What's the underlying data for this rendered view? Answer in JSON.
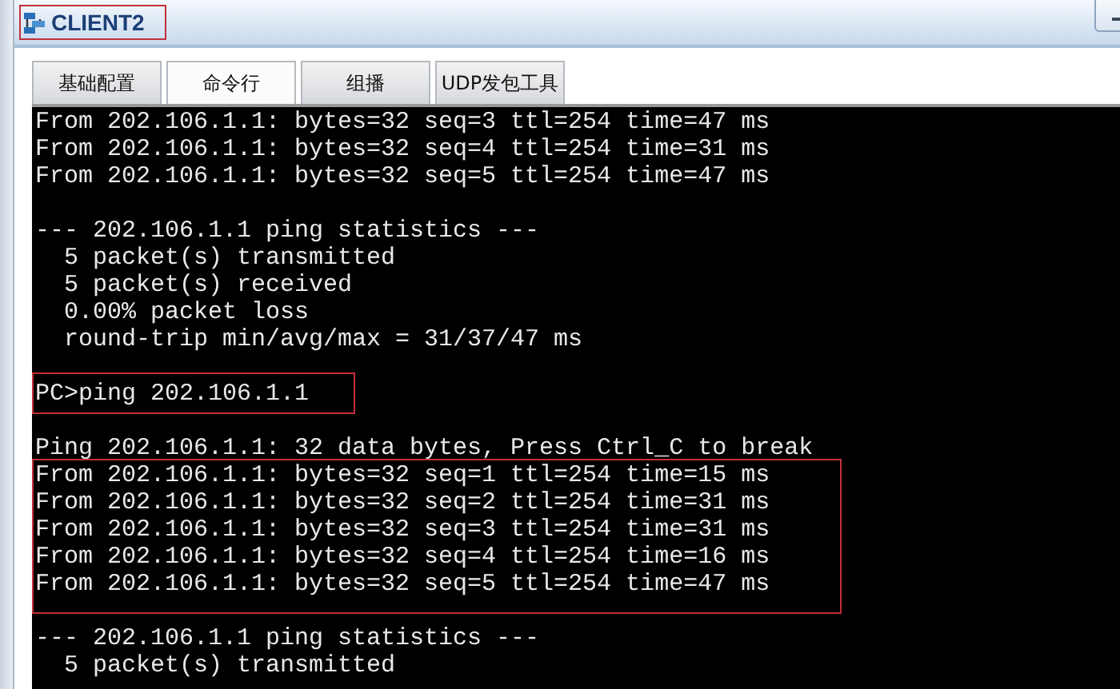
{
  "window": {
    "title": "CLIENT2",
    "title_highlighted": true
  },
  "tabs": [
    {
      "label": "基础配置",
      "selected": false
    },
    {
      "label": "命令行",
      "selected": true
    },
    {
      "label": "组播",
      "selected": false
    },
    {
      "label": "UDP发包工具",
      "selected": false
    }
  ],
  "terminal": {
    "blocks": [
      {
        "lines": [
          {
            "text": "From 202.106.1.1: bytes=32 seq=3 ttl=254 time=47 ms",
            "highlighted": false
          },
          {
            "text": "From 202.106.1.1: bytes=32 seq=4 ttl=254 time=31 ms",
            "highlighted": false
          },
          {
            "text": "From 202.106.1.1: bytes=32 seq=5 ttl=254 time=47 ms",
            "highlighted": false
          }
        ]
      },
      {
        "lines": [
          {
            "text": "--- 202.106.1.1 ping statistics ---",
            "highlighted": false
          },
          {
            "text": "  5 packet(s) transmitted",
            "highlighted": false
          },
          {
            "text": "  5 packet(s) received",
            "highlighted": false
          },
          {
            "text": "  0.00% packet loss",
            "highlighted": false
          },
          {
            "text": "  round-trip min/avg/max = 31/37/47 ms",
            "highlighted": false
          }
        ]
      },
      {
        "lines": [
          {
            "text": "PC>ping 202.106.1.1",
            "highlighted": true
          }
        ]
      },
      {
        "lines": [
          {
            "text": "Ping 202.106.1.1: 32 data bytes, Press Ctrl_C to break",
            "highlighted": false
          },
          {
            "text": "From 202.106.1.1: bytes=32 seq=1 ttl=254 time=15 ms",
            "highlighted": true
          },
          {
            "text": "From 202.106.1.1: bytes=32 seq=2 ttl=254 time=31 ms",
            "highlighted": true
          },
          {
            "text": "From 202.106.1.1: bytes=32 seq=3 ttl=254 time=31 ms",
            "highlighted": true
          },
          {
            "text": "From 202.106.1.1: bytes=32 seq=4 ttl=254 time=16 ms",
            "highlighted": true
          },
          {
            "text": "From 202.106.1.1: bytes=32 seq=5 ttl=254 time=47 ms",
            "highlighted": true
          }
        ]
      },
      {
        "lines": [
          {
            "text": "--- 202.106.1.1 ping statistics ---",
            "highlighted": false
          },
          {
            "text": "  5 packet(s) transmitted",
            "highlighted": false
          }
        ]
      }
    ]
  }
}
